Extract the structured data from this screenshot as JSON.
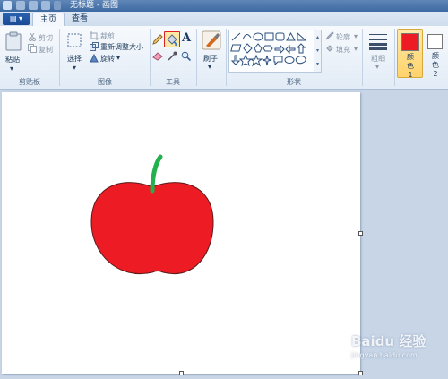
{
  "window": {
    "title": "无标题 - 画图"
  },
  "tabs": {
    "file_label": "▤ ▾",
    "home": "主页",
    "view": "查看"
  },
  "clipboard": {
    "paste": "粘贴",
    "cut": "剪切",
    "copy": "复制",
    "group": "剪贴板"
  },
  "image": {
    "select": "选择",
    "crop": "裁剪",
    "resize": "重新调整大小",
    "rotate": "旋转",
    "group": "图像"
  },
  "tools": {
    "group": "工具",
    "text_glyph": "A"
  },
  "brushes": {
    "label": "刷子"
  },
  "shapes": {
    "outline": "轮廓",
    "fill": "填充",
    "group": "形状"
  },
  "size": {
    "label": "粗细"
  },
  "colors": {
    "color1_label": "颜色 1",
    "color2_label": "颜色 2",
    "color1": "#ed1c24",
    "color2": "#ffffff"
  },
  "drawing": {
    "apple_color": "#ed1c24",
    "stem_color": "#22b14c"
  },
  "watermark": {
    "text": "Baidu 经验",
    "url": "jingyan.baidu.com"
  }
}
